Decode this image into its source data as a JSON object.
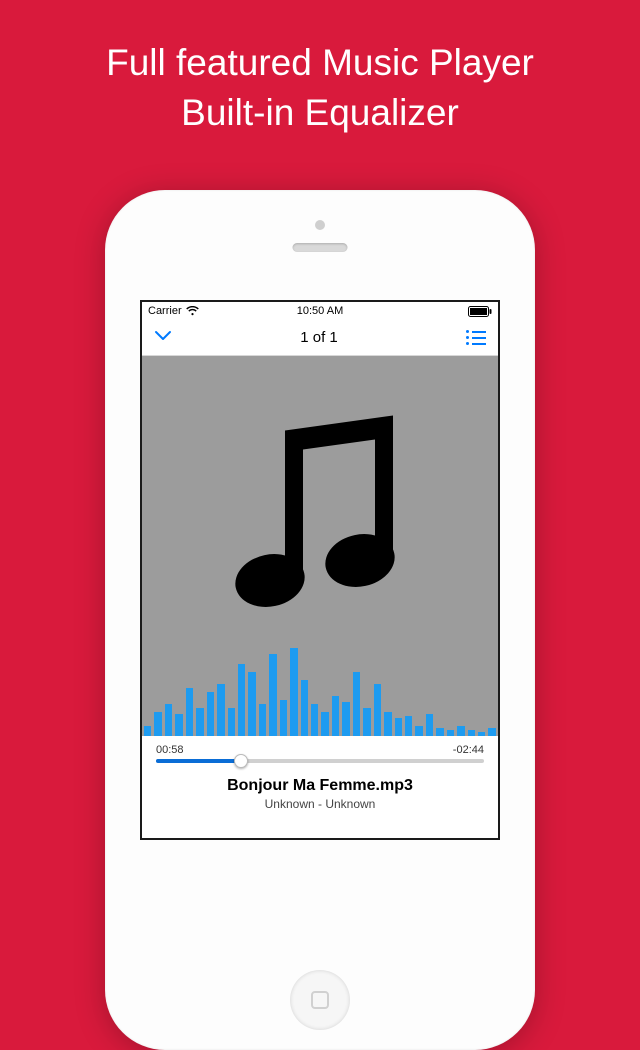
{
  "headline": {
    "line1": "Full featured Music Player",
    "line2": "Built-in Equalizer"
  },
  "status": {
    "carrier": "Carrier",
    "time": "10:50 AM"
  },
  "nav": {
    "title": "1 of 1"
  },
  "progress": {
    "elapsed": "00:58",
    "remaining": "-02:44",
    "percent": 26
  },
  "track": {
    "title": "Bonjour Ma Femme.mp3",
    "subtitle": "Unknown - Unknown"
  },
  "colors": {
    "accent": "#007aff",
    "eq": "#1d9bf0",
    "bg": "#d91a3c"
  },
  "equalizer_bars": [
    10,
    24,
    32,
    22,
    48,
    28,
    44,
    52,
    28,
    72,
    64,
    32,
    82,
    36,
    88,
    56,
    32,
    24,
    40,
    34,
    64,
    28,
    52,
    24,
    18,
    20,
    10,
    22,
    8,
    6,
    10,
    6,
    4,
    8
  ]
}
